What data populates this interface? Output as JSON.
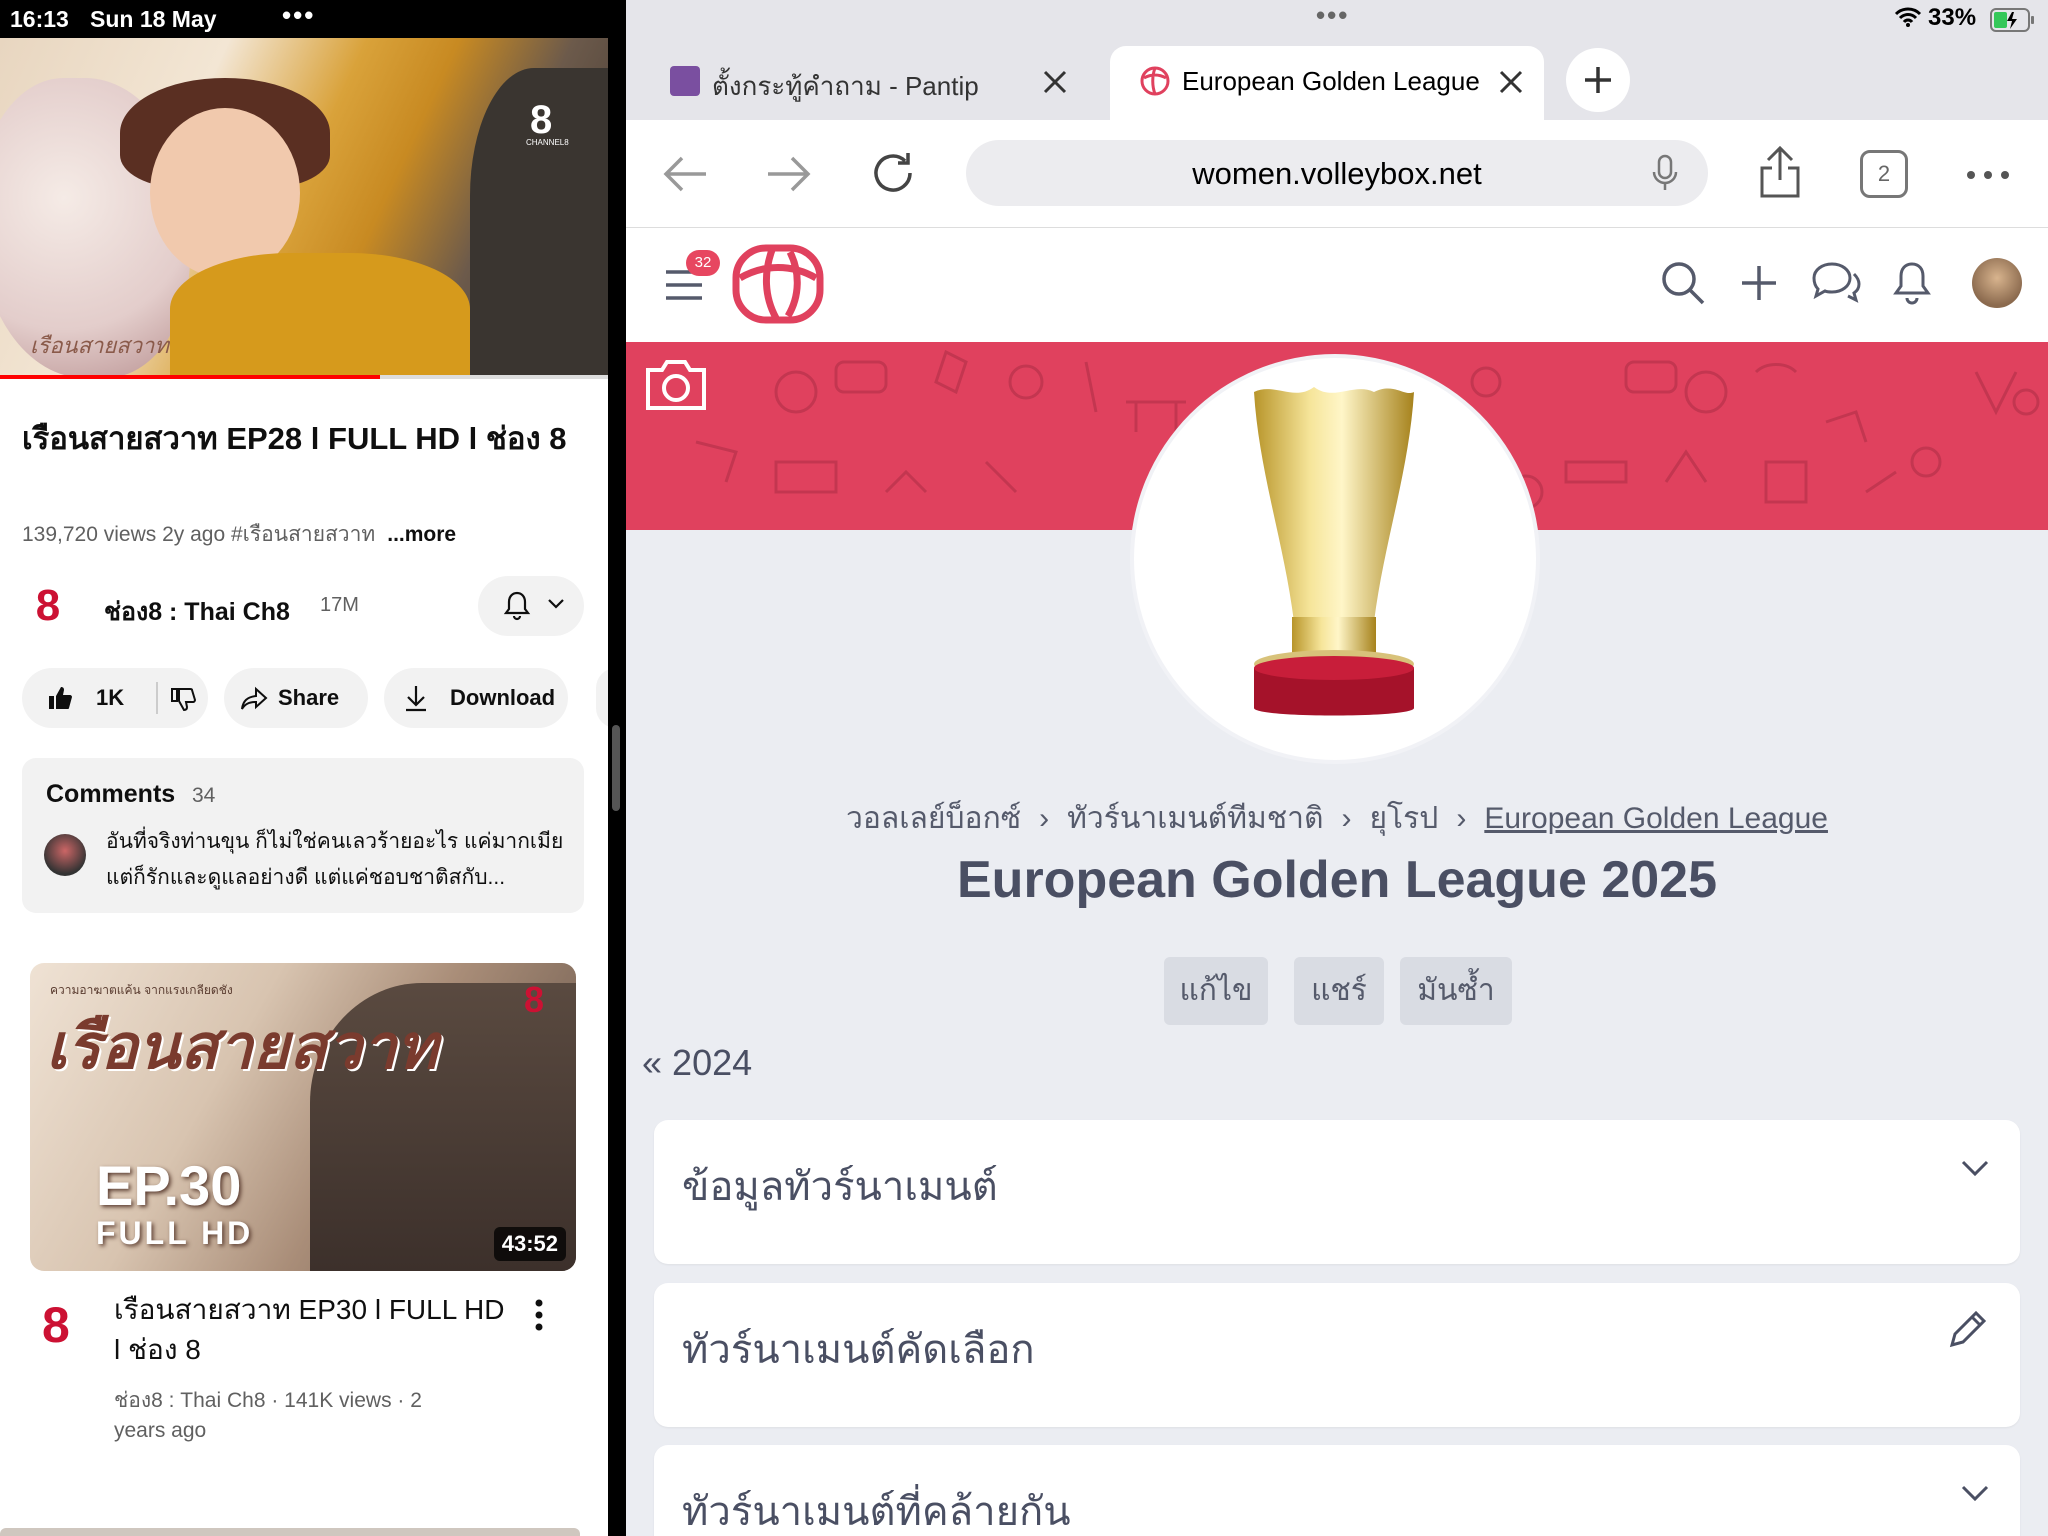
{
  "status_left": {
    "time": "16:13",
    "date": "Sun 18 May",
    "dots": "•••"
  },
  "youtube": {
    "player": {
      "channel_logo": "8",
      "channel_logo_sub": "CHANNEL8",
      "watermark": "เรือนสายสวาท",
      "progress": 0.625
    },
    "title": "เรือนสายสวาท EP28 l FULL HD l ช่อง 8",
    "meta": "139,720 views  2y ago  #เรือนสายสวาท",
    "more": "...more",
    "channel": {
      "avatar": "8",
      "name": "ช่อง8 : Thai Ch8",
      "subs": "17M"
    },
    "actions": {
      "likes": "1K",
      "share": "Share",
      "download": "Download"
    },
    "comments": {
      "heading": "Comments",
      "count": "34",
      "preview": "อันที่จริงท่านขุน ก็ไม่ใช่คนเลวร้ายอะไร แค่มากเมีย แต่ก็รักและดูแลอย่างดี แต่แค่ชอบชาติสกับ..."
    },
    "next_video": {
      "thumb_tag": "ความอาฆาตแค้น จากแรงเกลียดชัง",
      "thumb_title": "เรือนสายสวาท",
      "thumb_ep": "EP.30",
      "thumb_fhd": "FULL HD",
      "thumb_logo": "8",
      "duration": "43:52",
      "avatar": "8",
      "title": "เรือนสายสวาท EP30  l FULL HD l ช่อง 8",
      "meta": "ช่อง8 : Thai Ch8 · 141K views · 2 years ago"
    }
  },
  "browser": {
    "dots": "•••",
    "battery": "33%",
    "tabs": [
      {
        "label": "ตั้งกระทู้คำถาม - Pantip",
        "active": false
      },
      {
        "label": "European Golden League",
        "active": true
      }
    ],
    "url": "women.volleybox.net",
    "tab_count": "2"
  },
  "site": {
    "menu_badge": "32",
    "breadcrumbs": [
      "วอลเลย์บ็อกซ์",
      "ทัวร์นาเมนต์ทีมชาติ",
      "ยุโรป",
      "European Golden League"
    ],
    "title": "European Golden League 2025",
    "actions": [
      "แก้ไข",
      "แชร์",
      "มันซ้ำ"
    ],
    "prev_year": "2024",
    "sections": [
      "ข้อมูลทัวร์นาเมนต์",
      "ทัวร์นาเมนต์คัดเลือก",
      "ทัวร์นาเมนต์ที่คล้ายกัน"
    ]
  },
  "colors": {
    "accent": "#e0415e",
    "badge": "#e74660",
    "youtube_red": "#ff0000"
  }
}
